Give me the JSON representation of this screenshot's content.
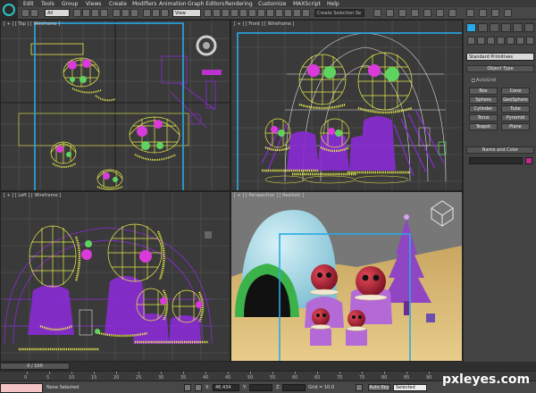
{
  "menu": [
    "Edit",
    "Tools",
    "Group",
    "Views",
    "Create",
    "Modifiers",
    "Animation",
    "Graph Editors",
    "Rendering",
    "Customize",
    "MAXScript",
    "Help"
  ],
  "toolbar": {
    "selection_filter": "All",
    "reference_coord": "View",
    "named_selection": "Create Selection Se"
  },
  "viewports": {
    "top": "[ + ] [ Top ] [ Wireframe ]",
    "front": "[ + ] [ Front ] [ Wireframe ]",
    "left": "[ + ] [ Left ] [ Wireframe ]",
    "perspective": "[ + ] [ Perspective ] [ Realistic ]"
  },
  "command_panel": {
    "category": "Standard Primitives",
    "object_type_title": "Object Type",
    "autogrid_label": "AutoGrid",
    "buttons": [
      "Box",
      "Cone",
      "Sphere",
      "GeoSphere",
      "Cylinder",
      "Tube",
      "Torus",
      "Pyramid",
      "Teapot",
      "Plane"
    ],
    "name_color_title": "Name and Color",
    "swatch_color": "#c0288a"
  },
  "timeline": {
    "frame_display": "0 / 100",
    "ticks": [
      "0",
      "5",
      "10",
      "15",
      "20",
      "25",
      "30",
      "35",
      "40",
      "45",
      "50",
      "55",
      "60",
      "65",
      "70",
      "75",
      "80",
      "85",
      "90"
    ]
  },
  "status": {
    "selection": "None Selected",
    "x_label": "X:",
    "x_value": "46.434",
    "y_label": "Y:",
    "y_value": "",
    "z_label": "Z:",
    "z_value": "",
    "grid": "Grid = 10.0",
    "autokey": "Auto Key",
    "key_mode": "Selected"
  },
  "watermark": "pxleyes.com",
  "colors": {
    "wire_yellow": "#e8ec4a",
    "wire_purple": "#8a2bd6",
    "wire_magenta": "#d93ad9",
    "wire_green": "#5fd35f",
    "selection_cyan": "#29a9e6",
    "ground_sand": "#d9b870",
    "igloo_blue": "#a8dbe8",
    "tree_purple": "#9046c2"
  }
}
